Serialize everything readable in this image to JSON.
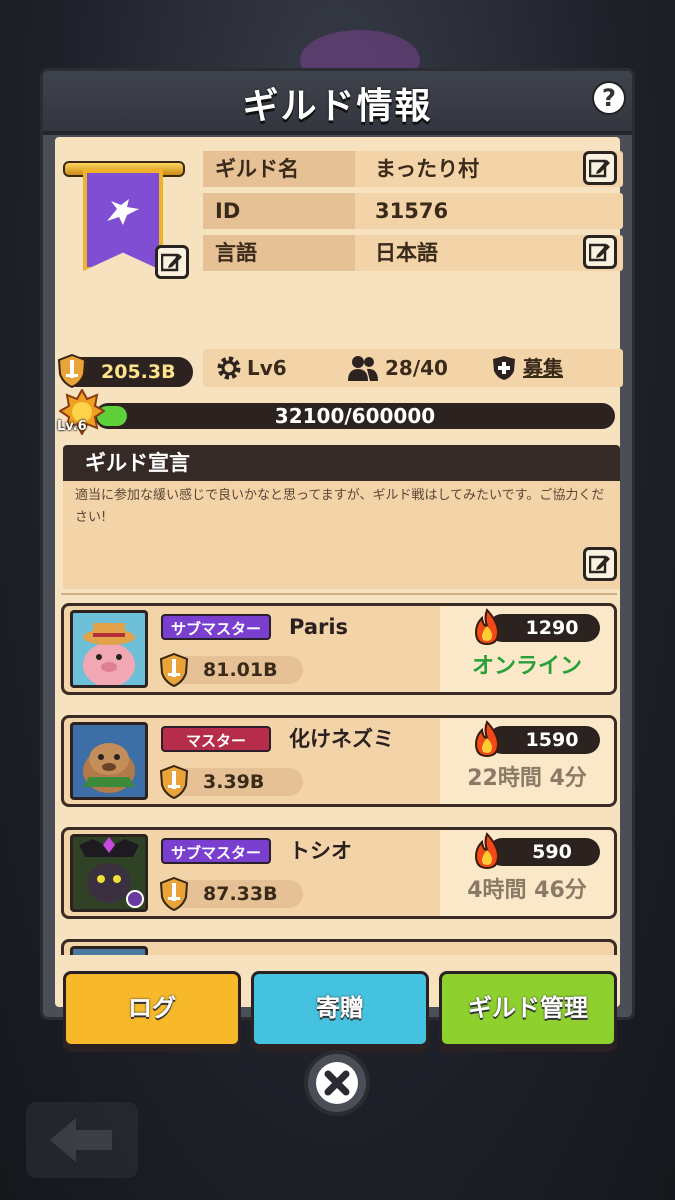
{
  "title": "ギルド情報",
  "help_icon": "?",
  "guild": {
    "name_label": "ギルド名",
    "name_value": "まったり村",
    "id_label": "ID",
    "id_value": "31576",
    "lang_label": "言語",
    "lang_value": "日本語",
    "power": "205.3B",
    "level": "Lv6",
    "members": "28/40",
    "recruit": "募集",
    "xp_text": "32100/600000",
    "xp_current": 32100,
    "xp_max": 600000,
    "badge_level": "Lv.6"
  },
  "declaration": {
    "title": "ギルド宣言",
    "text": "適当に参加な緩い感じで良いかなと思ってますが、ギルド戦はしてみたいです。ご協力ください!"
  },
  "members": [
    {
      "role": "サブマスター",
      "role_color": "#7b3fd0",
      "name": "Paris",
      "power": "81.01B",
      "fire": "1290",
      "status": "オンライン",
      "status_color": "#28a03a"
    },
    {
      "role": "マスター",
      "role_color": "#b52d4a",
      "name": "化けネズミ",
      "power": "3.39B",
      "fire": "1590",
      "status": "22時間 4分",
      "status_color": "#8a7a66"
    },
    {
      "role": "サブマスター",
      "role_color": "#7b3fd0",
      "name": "トシオ",
      "power": "87.33B",
      "fire": "590",
      "status": "4時間 46分",
      "status_color": "#8a7a66"
    }
  ],
  "buttons": {
    "log": "ログ",
    "donate": "寄贈",
    "manage": "ギルド管理"
  },
  "colors": {
    "log": "#f7b82a",
    "donate": "#45c2e0",
    "manage": "#8ed12e"
  }
}
